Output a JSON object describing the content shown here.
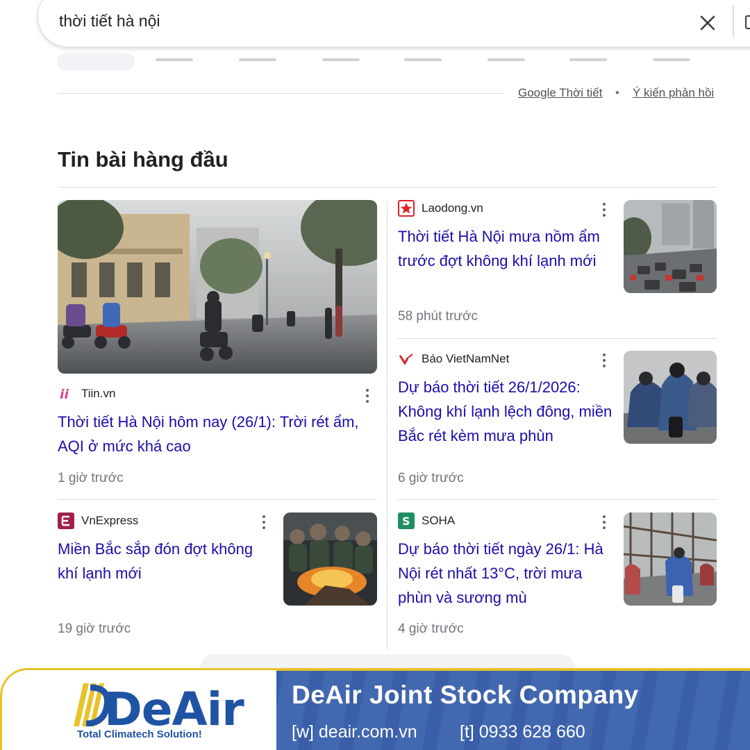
{
  "search": {
    "query": "thời tiết hà nội"
  },
  "weather_footer": {
    "source_link": "Google Thời tiết",
    "separator": "•",
    "feedback_link": "Ý kiến phản hồi"
  },
  "top_stories": {
    "title": "Tin bài hàng đầu",
    "stories": [
      {
        "source": "Tiin.vn",
        "headline": "Thời tiết Hà Nội hôm nay (26/1): Trời rét ẩm, AQI ở mức khá cao",
        "time": "1 giờ trước",
        "logo_icon": "tiin-logo-icon",
        "image": "foggy-street-photo"
      },
      {
        "source": "Laodong.vn",
        "headline": "Thời tiết Hà Nội mưa nồm ẩm trước đợt không khí lạnh mới",
        "time": "58 phút trước",
        "logo_icon": "laodong-star-icon",
        "image": "traffic-haze-photo"
      },
      {
        "source": "Báo VietNamNet",
        "headline": "Dự báo thời tiết 26/1/2026: Không khí lạnh lệch đông, miền Bắc rét kèm mưa phùn",
        "time": "6 giờ trước",
        "logo_icon": "vietnamnet-logo-icon",
        "image": "riders-raincoats-photo"
      },
      {
        "source": "VnExpress",
        "headline": "Miền Bắc sắp đón đợt không khí lạnh mới",
        "time": "19 giờ trước",
        "logo_icon": "vnexpress-logo-icon",
        "image": "fire-warming-photo"
      },
      {
        "source": "SOHA",
        "headline": "Dự báo thời tiết ngày 26/1: Hà Nội rét nhất 13°C, trời mưa phùn và sương mù",
        "time": "4 giờ trước",
        "logo_icon": "soha-logo-icon",
        "image": "bridge-riders-photo"
      }
    ]
  },
  "banner": {
    "brand": "DeAir",
    "tagline": "Total Climatech Solution!",
    "company": "DeAir Joint Stock Company",
    "website": "[w] deair.com.vn",
    "phone": "[t] 0933 628 660"
  },
  "colors": {
    "link_blue": "#1a0dab",
    "banner_blue": "#3a5fa8",
    "banner_gold": "#e8c22a",
    "brand_blue": "#1f53a4",
    "muted_gray": "#70757a"
  }
}
